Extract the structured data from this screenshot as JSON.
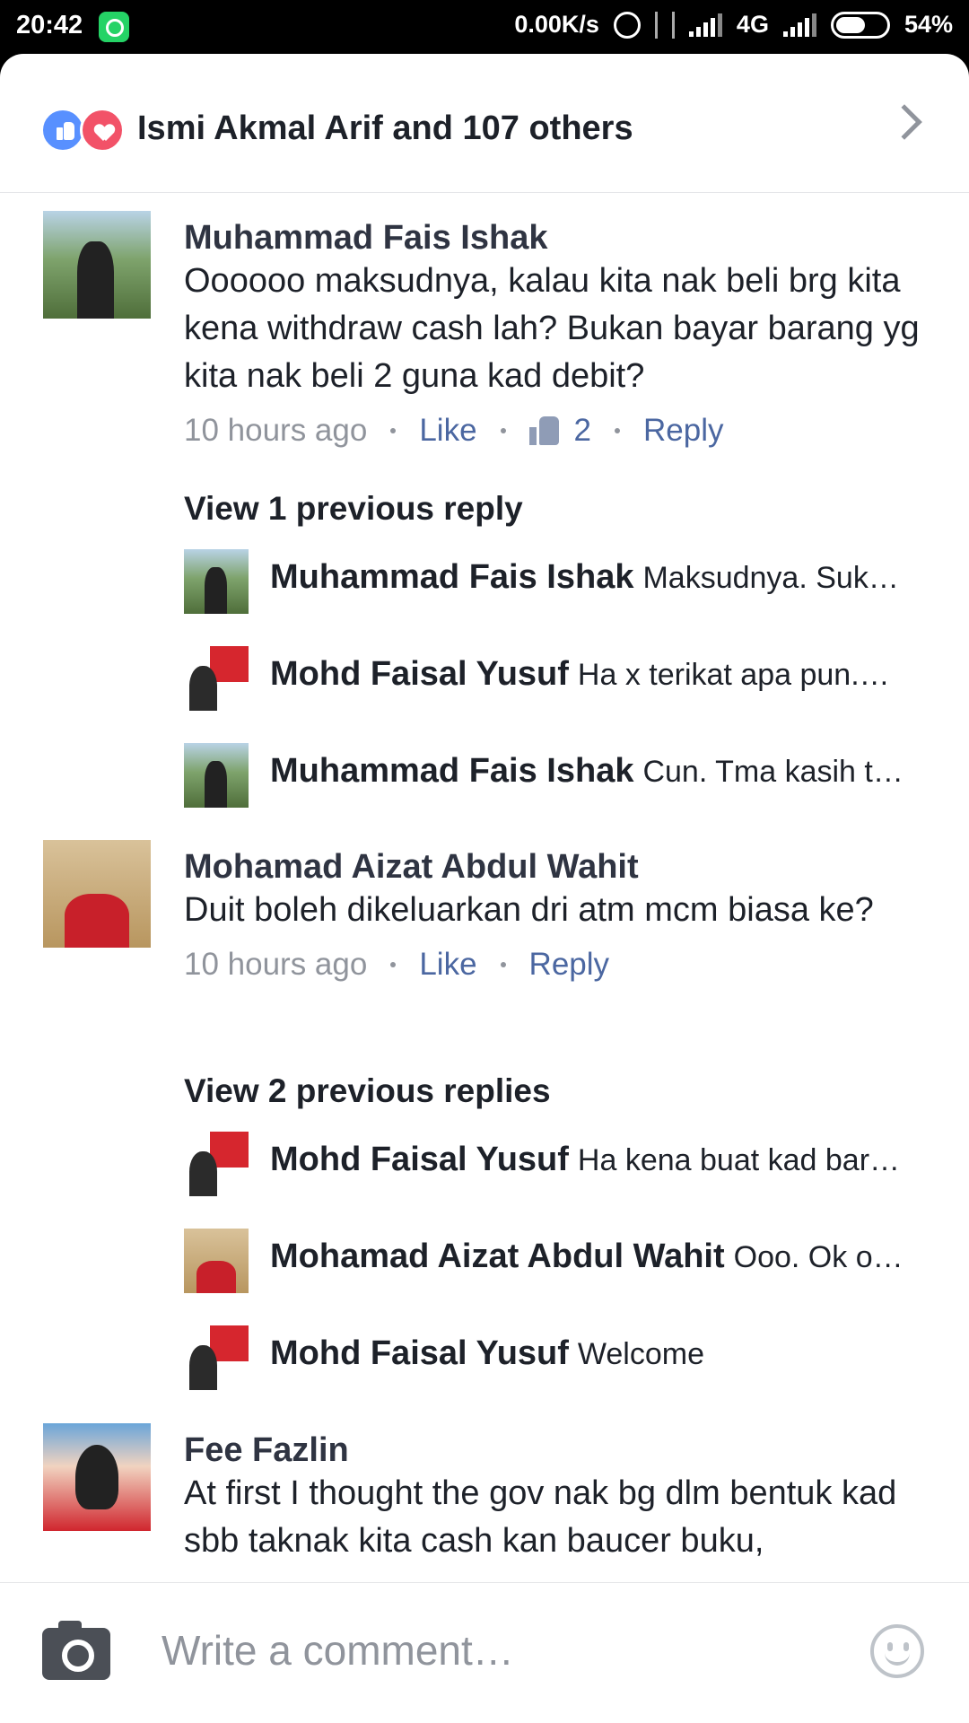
{
  "status_bar": {
    "time": "20:42",
    "network_speed": "0.00K/s",
    "network_type": "4G",
    "battery": "54%",
    "icons": [
      "whatsapp-icon",
      "alarm-icon",
      "data-transfer-icon",
      "signal-icon",
      "battery-icon"
    ]
  },
  "reactions": {
    "summary": "Ismi Akmal Arif and 107 others",
    "icons": [
      "like-icon",
      "love-icon",
      "chevron-right-icon"
    ],
    "colors": {
      "like": "#5890ff",
      "love": "#f25268"
    }
  },
  "comments": [
    {
      "author": "Muhammad Fais Ishak",
      "text": "Oooooo maksudnya, kalau kita nak beli brg kita kena withdraw cash lah? Bukan bayar barang yg kita nak beli 2 guna kad debit?",
      "time": "10 hours ago",
      "like_label": "Like",
      "like_count": "2",
      "reply_label": "Reply",
      "view_previous": "View 1 previous reply",
      "replies": [
        {
          "author": "Muhammad Fais Ishak",
          "text": "Maksudnya. Suk…"
        },
        {
          "author": "Mohd Faisal Yusuf",
          "text": "Ha x terikat apa pun.…"
        },
        {
          "author": "Muhammad Fais Ishak",
          "text": "Cun. Tma kasih t…"
        }
      ]
    },
    {
      "author": "Mohamad Aizat Abdul Wahit",
      "text": "Duit boleh dikeluarkan dri atm mcm biasa ke?",
      "time": "10 hours ago",
      "like_label": "Like",
      "reply_label": "Reply",
      "view_previous": "View 2 previous replies",
      "replies": [
        {
          "author": "Mohd Faisal Yusuf",
          "text": "Ha kena buat kad bar…"
        },
        {
          "author": "Mohamad Aizat Abdul Wahit",
          "text": "Ooo. Ok o…"
        },
        {
          "author": "Mohd Faisal Yusuf",
          "text": "Welcome"
        }
      ]
    },
    {
      "author": "Fee Fazlin",
      "text": "At first I thought the gov nak bg dlm bentuk kad sbb taknak kita cash kan baucer buku,"
    }
  ],
  "composer": {
    "placeholder": "Write a comment…",
    "icons": [
      "camera-icon",
      "emoji-icon"
    ]
  }
}
